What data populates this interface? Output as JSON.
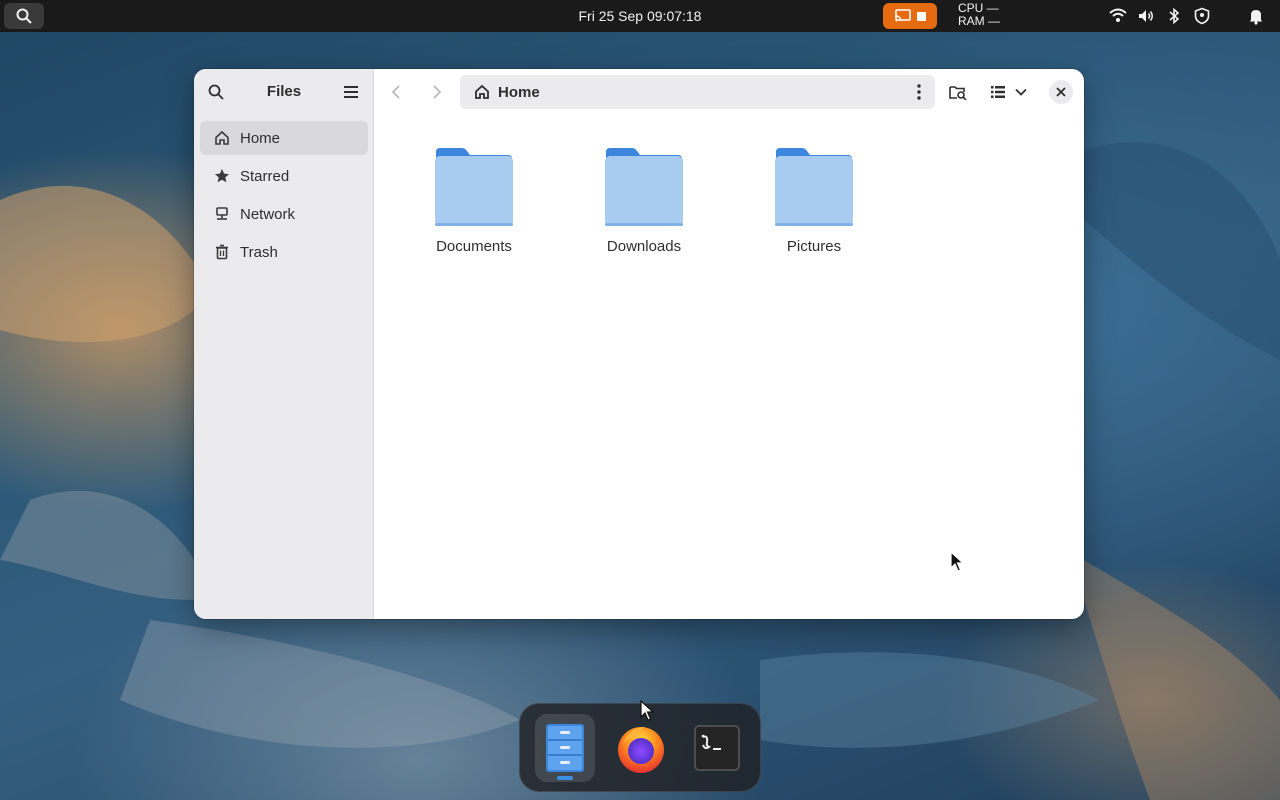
{
  "topbar": {
    "clock": "Fri 25 Sep  09:07:18",
    "cpu_label": "CPU —",
    "ram_label": "RAM —",
    "cast_color": "#e66a10",
    "tray_icons": [
      "wifi-icon",
      "volume-icon",
      "bluetooth-icon",
      "shield-icon",
      "bell-icon"
    ]
  },
  "window": {
    "sidebar": {
      "title": "Files",
      "items": [
        {
          "label": "Home",
          "icon": "home-icon",
          "active": true
        },
        {
          "label": "Starred",
          "icon": "star-icon",
          "active": false
        },
        {
          "label": "Network",
          "icon": "network-icon",
          "active": false
        },
        {
          "label": "Trash",
          "icon": "trash-icon",
          "active": false
        }
      ]
    },
    "pathbar": {
      "location": "Home",
      "icon": "home-icon"
    },
    "folders": [
      {
        "name": "Documents"
      },
      {
        "name": "Downloads"
      },
      {
        "name": "Pictures"
      }
    ],
    "folder_color": "#a8cbf0",
    "folder_tab_color": "#3d86de"
  },
  "dock": {
    "apps": [
      {
        "name": "Files",
        "running": true
      },
      {
        "name": "Firefox",
        "running": false
      },
      {
        "name": "Terminal",
        "running": false
      }
    ],
    "running_indicator_color": "#3d8ee6"
  }
}
